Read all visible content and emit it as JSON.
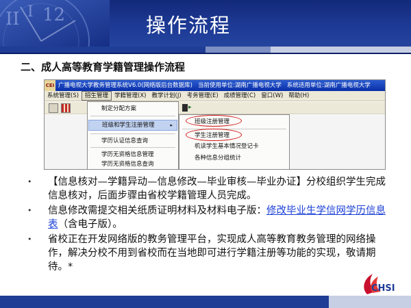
{
  "slide": {
    "title": "操作流程",
    "section_heading": "二、成人高等教育学籍管理操作流程"
  },
  "window": {
    "app_badge": "CEI",
    "title_segments": [
      "广播电视大学教务管理系统V6.0(网络版后台数据库)",
      "当前使用单位:湖南广播电视大学",
      "系统适用单位:湖南广播电视大学"
    ],
    "menu": [
      {
        "label": "系统管理(S)",
        "active": false
      },
      {
        "label": "招生管理",
        "active": true
      },
      {
        "label": "学籍管理(X)",
        "active": false
      },
      {
        "label": "教学计划(J)",
        "active": false
      },
      {
        "label": "考务管理(E)",
        "active": false
      },
      {
        "label": "成绩管理(C)",
        "active": false
      },
      {
        "label": "窗口(W)",
        "active": false
      },
      {
        "label": "帮助(H)",
        "active": false
      }
    ],
    "dropdown": {
      "item_allot": "制定分配方案",
      "item_class": "班级和学生注册管理",
      "item_verify": "学历认证信息查询",
      "item_noqual1": "学历无资格信息管理",
      "item_noqual2": "学历无资格信息查询",
      "submenu_arrow": "▸"
    },
    "submenu": {
      "item_class_reg": "班级注册管理",
      "item_student_reg": "学生注册管理",
      "item_basic_reg": "机读学生基本情况登记卡",
      "item_stats": "各种信息分组统计"
    }
  },
  "bullets": {
    "b1": "【信息核对—学籍异动—信息修改—毕业审核—毕业办证】分校组织学生完成信息核对，后面步骤由省校学籍管理人员完成。",
    "b2_pre": "信息修改需提交相关纸质证明材料及材料电子版：",
    "b2_link": "修改毕业生学信网学历信息表",
    "b2_post": "（含电子版）。",
    "b3": "省校正在开发网络版的教务管理平台，实现成人高等教育教务管理的网络操作，解决分校不用到省校而在当地即可进行学籍注册等功能的实现，敬请期待。*"
  },
  "logo": {
    "text": "CHSI"
  },
  "colors": {
    "banner": "#1d3a95",
    "link": "#1a3fd6",
    "highlight_oval": "#d21a1a",
    "menu_highlight": "#c2d3f2"
  }
}
